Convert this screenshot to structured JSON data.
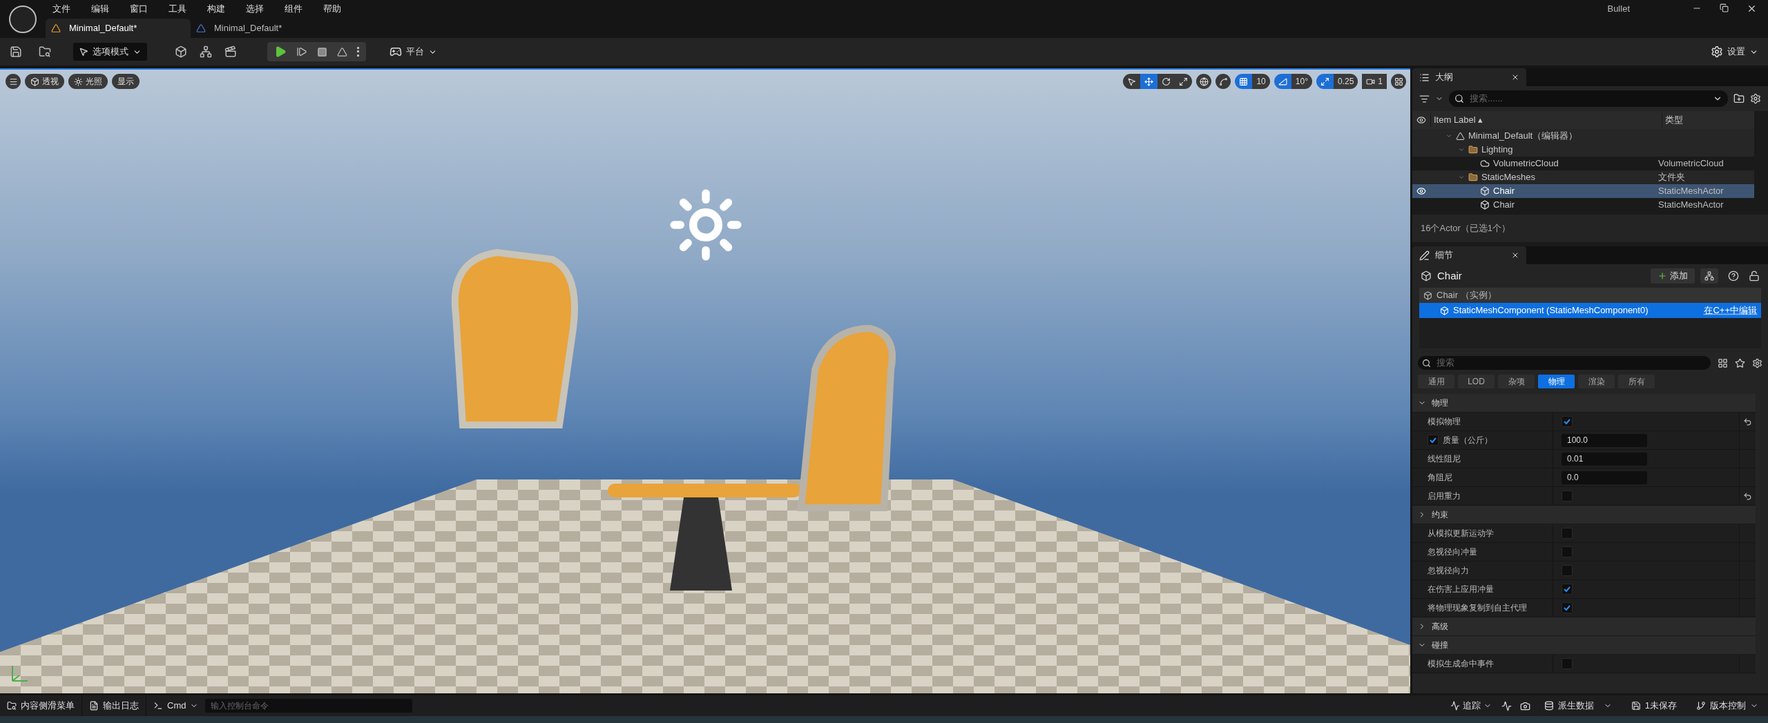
{
  "title_bar": {
    "menus": [
      "文件",
      "编辑",
      "窗口",
      "工具",
      "构建",
      "选择",
      "组件",
      "帮助"
    ],
    "project": "Bullet"
  },
  "doc_tabs": [
    {
      "label": "Minimal_Default*",
      "selected": true
    },
    {
      "label": "Minimal_Default*",
      "selected": false
    }
  ],
  "toolbar": {
    "mode": "选项模式",
    "platform": "平台",
    "settings": "设置"
  },
  "viewport": {
    "left_buttons": [
      {
        "kind": "menu"
      },
      {
        "kind": "cube",
        "label": "透视"
      },
      {
        "kind": "light",
        "label": "光照"
      },
      {
        "kind": "plain",
        "label": "显示"
      }
    ],
    "transform_tools": [
      {
        "kind": "select",
        "selected": false
      },
      {
        "kind": "move",
        "selected": true
      },
      {
        "kind": "rotate",
        "selected": false
      },
      {
        "kind": "scale",
        "selected": false
      }
    ],
    "snaps": [
      {
        "kind": "grid",
        "value": "10",
        "on": true
      },
      {
        "kind": "angle",
        "value": "10°",
        "on": true
      },
      {
        "kind": "scale",
        "value": "0.25",
        "on": true
      }
    ],
    "camera_speed": "1"
  },
  "outliner": {
    "tab": "大纲",
    "search_placeholder": "搜索......",
    "columns": [
      "Item Label",
      "类型"
    ],
    "sort_indicator": "▴",
    "rows": [
      {
        "kind": "level",
        "label": "Minimal_Default（编辑器）",
        "selected": false,
        "children": [
          {
            "kind": "folder",
            "label": "Lighting",
            "selected": false,
            "children": [
              {
                "kind": "cloud",
                "label": "VolumetricCloud",
                "type": "VolumetricCloud",
                "selected": false
              }
            ]
          },
          {
            "kind": "folder",
            "label": "StaticMeshes",
            "type": "文件夹",
            "selected": false,
            "children": [
              {
                "kind": "mesh",
                "label": "Chair",
                "type": "StaticMeshActor",
                "selected": true
              },
              {
                "kind": "mesh",
                "label": "Chair",
                "type": "StaticMeshActor",
                "selected": false
              }
            ]
          }
        ]
      }
    ],
    "footer": "16个Actor（已选1个）"
  },
  "details": {
    "tab": "细节",
    "actor": "Chair",
    "add_button": "添加",
    "instance": "Chair （实例）",
    "component": "StaticMeshComponent (StaticMeshComponent0)",
    "component_link": "在C++中编辑",
    "search_placeholder": "搜索",
    "filters": [
      {
        "label": "通用",
        "selected": false
      },
      {
        "label": "LOD",
        "selected": false
      },
      {
        "label": "杂项",
        "selected": false
      },
      {
        "label": "物理",
        "selected": true
      },
      {
        "label": "渲染",
        "selected": false
      },
      {
        "label": "所有",
        "selected": false
      }
    ],
    "rows": [
      {
        "kind": "section",
        "label": "物理",
        "expanded": true
      },
      {
        "kind": "checkbox",
        "label": "模拟物理",
        "checked": true,
        "resettable": true
      },
      {
        "kind": "number",
        "label": "质量（公斤）",
        "value": "100.0",
        "enabled": true
      },
      {
        "kind": "number",
        "label": "线性阻尼",
        "value": "0.01"
      },
      {
        "kind": "number",
        "label": "角阻尼",
        "value": "0.0"
      },
      {
        "kind": "checkbox",
        "label": "启用重力",
        "checked": false,
        "resettable": true
      },
      {
        "kind": "section",
        "label": "约束",
        "expanded": false
      },
      {
        "kind": "checkbox",
        "label": "从模拟更新运动学",
        "checked": false,
        "resettable": false
      },
      {
        "kind": "checkbox",
        "label": "忽视径向冲量",
        "checked": false,
        "resettable": false
      },
      {
        "kind": "checkbox",
        "label": "忽视径向力",
        "checked": false,
        "resettable": false
      },
      {
        "kind": "checkbox",
        "label": "在伤害上应用冲量",
        "checked": true,
        "resettable": false
      },
      {
        "kind": "checkbox",
        "label": "将物理现象复制到自主代理",
        "checked": true,
        "resettable": false
      },
      {
        "kind": "section",
        "label": "高级",
        "expanded": false
      },
      {
        "kind": "section",
        "label": "碰撞",
        "expanded": true
      },
      {
        "kind": "checkbox",
        "label": "模拟生成命中事件",
        "checked": false,
        "resettable": false
      }
    ]
  },
  "status_bar": {
    "content_drawer": "内容侧滑菜单",
    "output_log": "输出日志",
    "cmd": "Cmd",
    "console_placeholder": "输入控制台命令",
    "trace": "追踪",
    "derived_data": "派生数据",
    "unsaved": "1未保存",
    "source_control": "版本控制"
  }
}
